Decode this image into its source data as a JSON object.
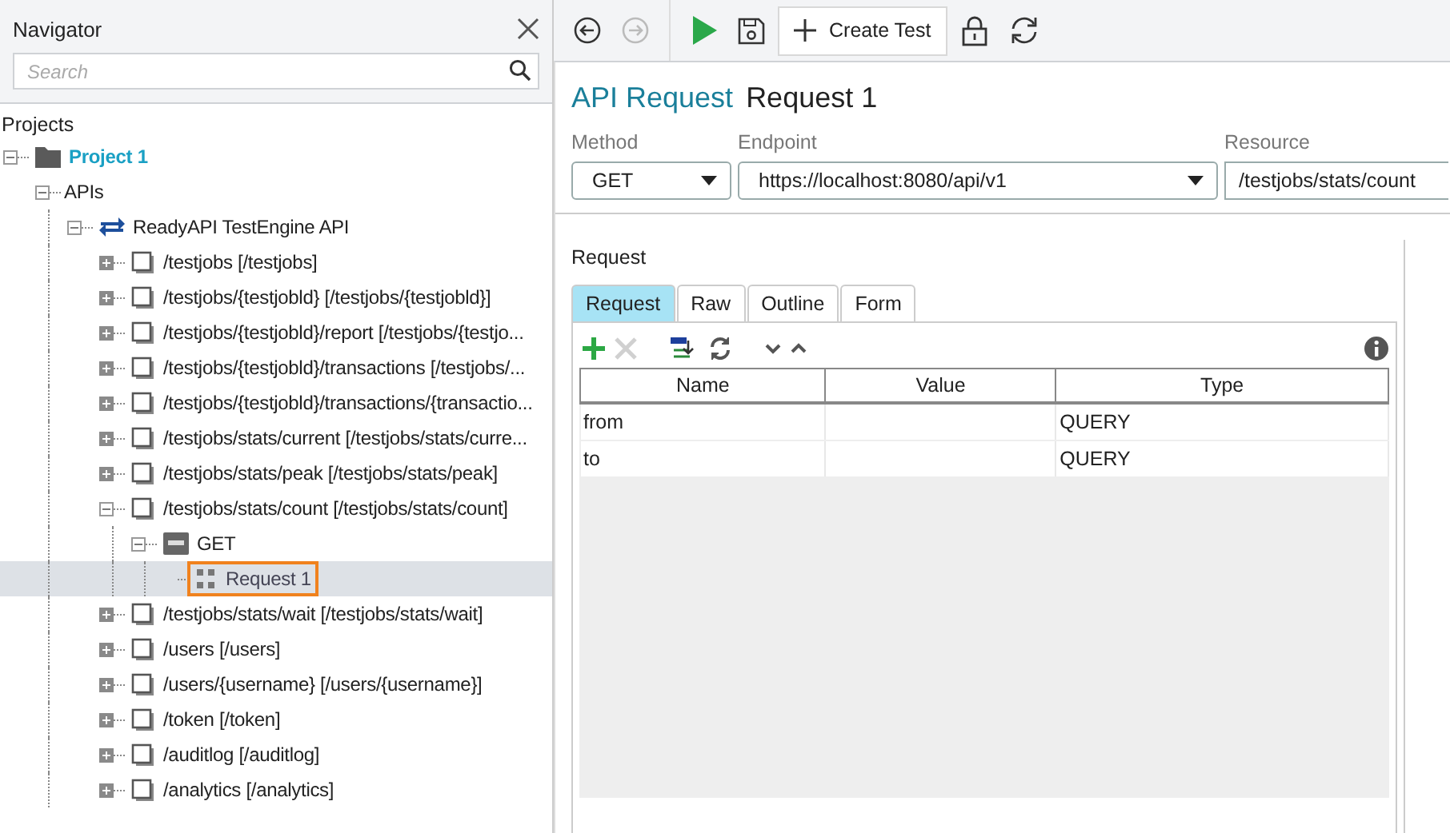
{
  "navigator": {
    "title": "Navigator",
    "search": {
      "placeholder": "Search"
    },
    "section": "Projects",
    "tree": [
      {
        "label": "Project 1",
        "kind": "project",
        "expanded": true,
        "selected": false,
        "children": [
          {
            "label": "APIs",
            "kind": "group",
            "expanded": true,
            "selected": false,
            "children": [
              {
                "label": "ReadyAPI TestEngine API",
                "kind": "api",
                "expanded": true,
                "selected": false,
                "children": [
                  {
                    "label": "/testjobs [/testjobs]",
                    "kind": "resource",
                    "expanded": false,
                    "selected": false
                  },
                  {
                    "label": "/testjobs/{testjobld} [/testjobs/{testjobld}]",
                    "kind": "resource",
                    "expanded": false,
                    "selected": false
                  },
                  {
                    "label": "/testjobs/{testjobld}/report [/testjobs/{testjo...",
                    "kind": "resource",
                    "expanded": false,
                    "selected": false
                  },
                  {
                    "label": "/testjobs/{testjobld}/transactions [/testjobs/...",
                    "kind": "resource",
                    "expanded": false,
                    "selected": false
                  },
                  {
                    "label": "/testjobs/{testjobld}/transactions/{transactio...",
                    "kind": "resource",
                    "expanded": false,
                    "selected": false
                  },
                  {
                    "label": "/testjobs/stats/current [/testjobs/stats/curre...",
                    "kind": "resource",
                    "expanded": false,
                    "selected": false
                  },
                  {
                    "label": "/testjobs/stats/peak [/testjobs/stats/peak]",
                    "kind": "resource",
                    "expanded": false,
                    "selected": false
                  },
                  {
                    "label": "/testjobs/stats/count [/testjobs/stats/count]",
                    "kind": "resource",
                    "expanded": true,
                    "selected": false,
                    "children": [
                      {
                        "label": "GET",
                        "kind": "method",
                        "expanded": true,
                        "selected": false,
                        "children": [
                          {
                            "label": "Request 1",
                            "kind": "request",
                            "selected": true
                          }
                        ]
                      }
                    ]
                  },
                  {
                    "label": "/testjobs/stats/wait [/testjobs/stats/wait]",
                    "kind": "resource",
                    "expanded": false,
                    "selected": false
                  },
                  {
                    "label": "/users [/users]",
                    "kind": "resource",
                    "expanded": false,
                    "selected": false
                  },
                  {
                    "label": "/users/{username} [/users/{username}]",
                    "kind": "resource",
                    "expanded": false,
                    "selected": false
                  },
                  {
                    "label": "/token [/token]",
                    "kind": "resource",
                    "expanded": false,
                    "selected": false
                  },
                  {
                    "label": "/auditlog [/auditlog]",
                    "kind": "resource",
                    "expanded": false,
                    "selected": false
                  },
                  {
                    "label": "/analytics [/analytics]",
                    "kind": "resource",
                    "expanded": false,
                    "selected": false
                  }
                ]
              }
            ]
          }
        ]
      }
    ]
  },
  "toolbar": [
    {
      "kind": "back",
      "disabled": false
    },
    {
      "kind": "forward",
      "disabled": true
    },
    {
      "kind": "run",
      "disabled": false
    },
    {
      "kind": "save",
      "disabled": false
    },
    {
      "kind": "create",
      "label": "Create Test",
      "disabled": false
    },
    {
      "kind": "lock",
      "disabled": false
    },
    {
      "kind": "refresh",
      "disabled": false
    }
  ],
  "editor": {
    "type": "API Request",
    "name": "Request 1",
    "fields": [
      {
        "label": "Method",
        "value": "GET",
        "kind": "dropdown"
      },
      {
        "label": "Endpoint",
        "value": "https://localhost:8080/api/v1",
        "kind": "dropdown"
      },
      {
        "label": "Resource",
        "value": "/testjobs/stats/count",
        "kind": "text"
      }
    ],
    "section": "Request",
    "tabs": [
      {
        "label": "Request",
        "selected": true
      },
      {
        "label": "Raw",
        "selected": false
      },
      {
        "label": "Outline",
        "selected": false
      },
      {
        "label": "Form",
        "selected": false
      }
    ],
    "tools": [
      {
        "kind": "add",
        "disabled": false
      },
      {
        "kind": "remove",
        "disabled": true
      },
      {
        "kind": "url",
        "disabled": false
      },
      {
        "kind": "sync",
        "disabled": false
      },
      {
        "kind": "down",
        "disabled": false
      },
      {
        "kind": "up",
        "disabled": false
      },
      {
        "kind": "info",
        "disabled": false
      }
    ],
    "table": {
      "columns": [
        "Name",
        "Value",
        "Type"
      ],
      "rows": [
        {
          "name": "from",
          "type": "QUERY"
        },
        {
          "name": "to",
          "type": "QUERY"
        }
      ]
    }
  }
}
